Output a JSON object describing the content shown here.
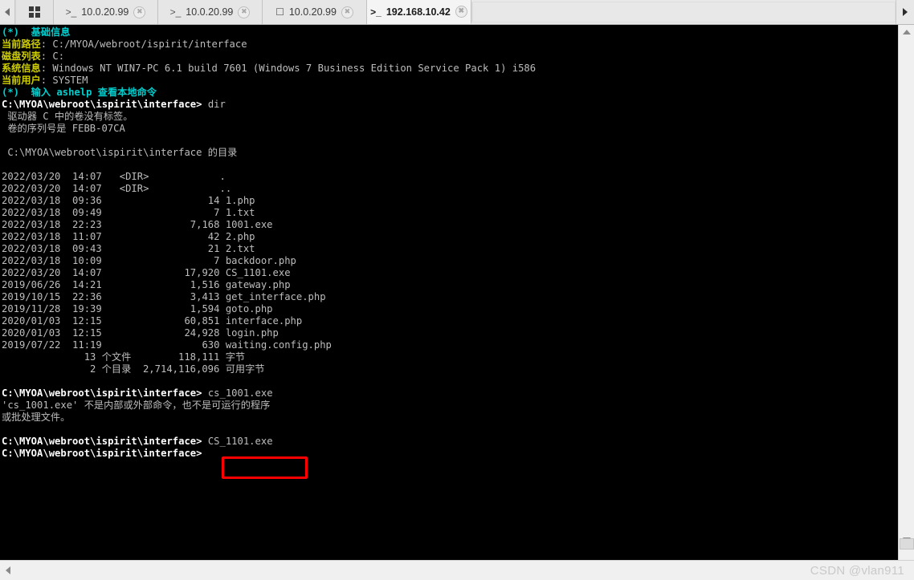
{
  "tabbar": {
    "nav_left_icon": "chevron-left-icon",
    "nav_right_icon": "chevron-right-icon",
    "grid_icon": "grid-icon",
    "tabs": [
      {
        "icon": ">_",
        "icon_name": "terminal-icon",
        "label": "10.0.20.99",
        "active": false,
        "close_label": "✖"
      },
      {
        "icon": ">_",
        "icon_name": "terminal-icon",
        "label": "10.0.20.99",
        "active": false,
        "close_label": "✖"
      },
      {
        "icon": "☐",
        "icon_name": "folder-icon",
        "label": "10.0.20.99",
        "active": false,
        "close_label": "✖"
      },
      {
        "icon": ">_",
        "icon_name": "terminal-icon",
        "label": "192.168.10.42",
        "active": true,
        "close_label": "✖"
      }
    ]
  },
  "colors": {
    "terminal_background": "#000000",
    "cyan": "#00cdcd",
    "yellow": "#cdcd00",
    "white": "#ffffff",
    "gray": "#bdbdbd",
    "highlight_box": "#ff0000"
  },
  "terminal": {
    "banner_title": "(*)  基础信息",
    "info": [
      {
        "label": "当前路径",
        "sep": ": ",
        "value": "C:/MYOA/webroot/ispirit/interface"
      },
      {
        "label": "磁盘列表",
        "sep": ": ",
        "value": "C:"
      },
      {
        "label": "系统信息",
        "sep": ": ",
        "value": "Windows NT WIN7-PC 6.1 build 7601 (Windows 7 Business Edition Service Pack 1) i586"
      },
      {
        "label": "当前用户",
        "sep": ": ",
        "value": "SYSTEM"
      }
    ],
    "help_hint": "(*)  输入 ashelp 查看本地命令",
    "prompt": "C:\\MYOA\\webroot\\ispirit\\interface>",
    "command_1": " dir",
    "dir_header": [
      " 驱动器 C 中的卷没有标签。",
      " 卷的序列号是 FEBB-07CA",
      "",
      " C:\\MYOA\\webroot\\ispirit\\interface 的目录",
      ""
    ],
    "dir_entries": [
      {
        "date": "2022/03/20",
        "time": "14:07",
        "size": "<DIR>",
        "name": "."
      },
      {
        "date": "2022/03/20",
        "time": "14:07",
        "size": "<DIR>",
        "name": ".."
      },
      {
        "date": "2022/03/18",
        "time": "09:36",
        "size": "14",
        "name": "1.php"
      },
      {
        "date": "2022/03/18",
        "time": "09:49",
        "size": "7",
        "name": "1.txt"
      },
      {
        "date": "2022/03/18",
        "time": "22:23",
        "size": "7,168",
        "name": "1001.exe"
      },
      {
        "date": "2022/03/18",
        "time": "11:07",
        "size": "42",
        "name": "2.php"
      },
      {
        "date": "2022/03/18",
        "time": "09:43",
        "size": "21",
        "name": "2.txt"
      },
      {
        "date": "2022/03/18",
        "time": "10:09",
        "size": "7",
        "name": "backdoor.php"
      },
      {
        "date": "2022/03/20",
        "time": "14:07",
        "size": "17,920",
        "name": "CS_1101.exe"
      },
      {
        "date": "2019/06/26",
        "time": "14:21",
        "size": "1,516",
        "name": "gateway.php"
      },
      {
        "date": "2019/10/15",
        "time": "22:36",
        "size": "3,413",
        "name": "get_interface.php"
      },
      {
        "date": "2019/11/28",
        "time": "19:39",
        "size": "1,594",
        "name": "goto.php"
      },
      {
        "date": "2020/01/03",
        "time": "12:15",
        "size": "60,851",
        "name": "interface.php"
      },
      {
        "date": "2020/01/03",
        "time": "12:15",
        "size": "24,928",
        "name": "login.php"
      },
      {
        "date": "2019/07/22",
        "time": "11:19",
        "size": "630",
        "name": "waiting.config.php"
      }
    ],
    "dir_summary": [
      "              13 个文件        118,111 字节",
      "               2 个目录  2,714,116,096 可用字节"
    ],
    "command_2": " cs_1001.exe",
    "error_lines": [
      "'cs_1001.exe' 不是内部或外部命令，也不是可运行的程序",
      "或批处理文件。"
    ],
    "command_3": " CS_1101.exe",
    "highlighted_command": "CS_1101.exe"
  },
  "scrollbars": {
    "vertical_up_icon": "arrow-up-icon",
    "vertical_down_icon": "arrow-down-icon",
    "horizontal_left_icon": "arrow-left-icon"
  },
  "watermark": "CSDN @vlan911"
}
